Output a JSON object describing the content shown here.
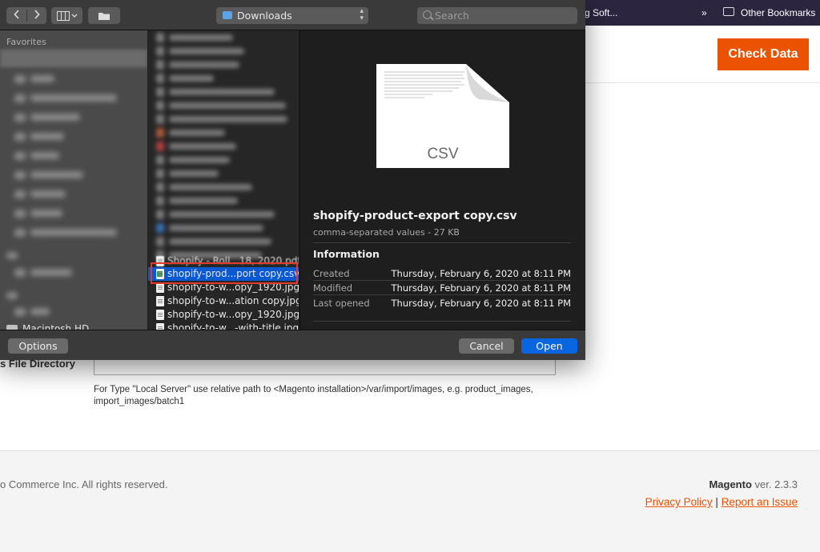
{
  "bookmarks": {
    "item_partial": "g Soft...",
    "overflow": "»",
    "other_bookmarks": "Other Bookmarks"
  },
  "magento": {
    "check_data_button": "Check Data",
    "images_dir_label": "s File Directory",
    "images_dir_value": "",
    "images_dir_note": "For Type \"Local Server\" use relative path to <Magento installation>/var/import/images, e.g. product_images, import_images/batch1",
    "copyright": "o Commerce Inc. All rights reserved.",
    "version_brand": "Magento",
    "version_text": " ver. 2.3.3",
    "privacy_policy": "Privacy Policy",
    "separator": "|",
    "report_issue": "Report an Issue",
    "accent_color": "#eb5202"
  },
  "dialog": {
    "toolbar": {
      "back_icon": "chevron-left-icon",
      "forward_icon": "chevron-right-icon",
      "view_icon": "column-view-icon",
      "new_folder_icon": "folder-icon",
      "location": "Downloads",
      "search_placeholder": "Search"
    },
    "sidebar": {
      "section_title": "Favorites",
      "volume": "Macintosh HD"
    },
    "files": [
      {
        "name": "shopify-prod...port copy.csv",
        "type": "csv",
        "selected": true
      },
      {
        "name": "shopify-to-w...opy_1920.jpg",
        "type": "jpg",
        "selected": false
      },
      {
        "name": "shopify-to-w...ation copy.jpg",
        "type": "jpg",
        "selected": false
      },
      {
        "name": "shopify-to-w...opy_1920.jpg",
        "type": "jpg",
        "selected": false
      },
      {
        "name": "shopify-to-w...-with-title.jpg",
        "type": "jpg",
        "selected": false
      }
    ],
    "partial_file_above": "Shopify - Roll...18, 2020.pdf",
    "preview": {
      "icon_label": "CSV",
      "file_name": "shopify-product-export copy.csv",
      "kind_size": "comma-separated values - 27 KB",
      "info_title": "Information",
      "created_label": "Created",
      "created_value": "Thursday, February 6, 2020 at 8:11 PM",
      "modified_label": "Modified",
      "modified_value": "Thursday, February 6, 2020 at 8:11 PM",
      "opened_label": "Last opened",
      "opened_value": "Thursday, February 6, 2020 at 8:11 PM"
    },
    "buttons": {
      "options": "Options",
      "cancel": "Cancel",
      "open": "Open"
    },
    "selection_color": "#0a59d1",
    "highlight_color": "#e23a2b"
  }
}
